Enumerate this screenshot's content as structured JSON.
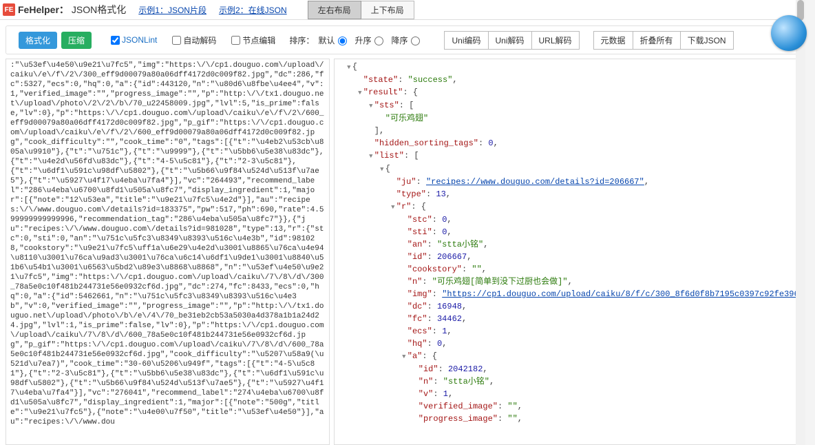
{
  "top": {
    "brand_icon": "FE",
    "brand": "FeHelper：",
    "subtitle": "JSON格式化",
    "example1": "示例1：JSON片段",
    "example2": "示例2：在线JSON",
    "layout_lr": "左右布局",
    "layout_tb": "上下布局"
  },
  "toolbar": {
    "format": "格式化",
    "compress": "压缩",
    "jsonlint": "JSONLint",
    "autodecode": "自动解码",
    "editnode": "节点编辑",
    "sort_label": "排序：",
    "sort_default": "默认",
    "sort_asc": "升序",
    "sort_desc": "降序",
    "uni_encode": "Uni编码",
    "uni_decode": "Uni解码",
    "url_decode": "URL解码",
    "meta": "元数据",
    "collapse_all": "折叠所有",
    "download": "下载JSON"
  },
  "raw": ":\"\\u53ef\\u4e50\\u9e21\\u7fc5\",\"img\":\"https:\\/\\/cp1.douguo.com\\/upload\\/caiku\\/e\\/f\\/2\\/300_eff9d00079a80a06dff4172d0c009f82.jpg\",\"dc\":286,\"fc\":5327,\"ecs\":0,\"hq\":0,\"a\":{\"id\":443120,\"n\":\"\\u80d6\\u8fbe\\u4ee4\",\"v\":1,\"verified_image\":\"\",\"progress_image\":\"\",\"p\":\"http:\\/\\/tx1.douguo.net\\/upload\\/photo\\/2\\/2\\/b\\/70_u22458009.jpg\",\"lvl\":5,\"is_prime\":false,\"lv\":0},\"p\":\"https:\\/\\/cp1.douguo.com\\/upload\\/caiku\\/e\\/f\\/2\\/600_eff9d00079a80a06dff4172d0c009f82.jpg\",\"p_gif\":\"https:\\/\\/cp1.douguo.com\\/upload\\/caiku\\/e\\/f\\/2\\/600_eff9d00079a80a06dff4172d0c009f82.jpg\",\"cook_difficulty\":\"\",\"cook_time\":\"0\",\"tags\":[{\"t\":\"\\u4eb2\\u53cb\\u805a\\u9910\"},{\"t\":\"\\u751c\"},{\"t\":\"\\u9999\"},{\"t\":\"\\u5bb6\\u5e38\\u83dc\"},{\"t\":\"\\u4e2d\\u56fd\\u83dc\"},{\"t\":\"4-5\\u5c81\"},{\"t\":\"2-3\\u5c81\"},{\"t\":\"\\u6df1\\u591c\\u98df\\u5802\"},{\"t\":\"\\u5b66\\u9f84\\u524d\\u513f\\u7ae5\"},{\"t\":\"\\u5927\\u4f17\\u4eba\\u7fa4\"}],\"vc\":\"264493\",\"recommend_label\":\"286\\u4eba\\u6700\\u8fd1\\u505a\\u8fc7\",\"display_ingredient\":1,\"major\":[{\"note\":\"12\\u53ea\",\"title\":\"\\u9e21\\u7fc5\\u4e2d\"}],\"au\":\"recipes:\\/\\/www.douguo.com\\/details?id=183375\",\"pw\":517,\"ph\":690,\"rate\":4.599999999999996,\"recommendation_tag\":\"286\\u4eba\\u505a\\u8fc7\"}},{\"ju\":\"recipes:\\/\\/www.douguo.com\\/details?id=981028\",\"type\":13,\"r\":{\"stc\":0,\"sti\":0,\"an\":\"\\u751c\\u5fc3\\u8349\\u8393\\u516c\\u4e3b\",\"id\":981028,\"cookstory\":\"\\u9e21\\u7fc5\\uff1a\\u6e29\\u4e2d\\u3001\\u8865\\u76ca\\u4e94\\u8110\\u3001\\u76ca\\u9ad3\\u3001\\u76ca\\u6c14\\u6df1\\u9de1\\u3001\\u8840\\u51b6\\u54b1\\u3001\\u6563\\u5bd2\\u89e3\\u8868\\u8868\",\"n\":\"\\u53ef\\u4e50\\u9e21\\u7fc5\",\"img\":\"https:\\/\\/cp1.douguo.com\\/upload\\/caiku\\/7\\/8\\/d\\/300_78a5e0c10f481b244731e56e0932cf6d.jpg\",\"dc\":274,\"fc\":8433,\"ecs\":0,\"hq\":0,\"a\":{\"id\":5462661,\"n\":\"\\u751c\\u5fc3\\u8349\\u8393\\u516c\\u4e3b\",\"v\":0,\"verified_image\":\"\",\"progress_image\":\"\",\"p\":\"http:\\/\\/tx1.douguo.net\\/upload\\/photo\\/b\\/e\\/4\\/70_be31eb2cb53a5030a4d378a1b1a24d24.jpg\",\"lvl\":1,\"is_prime\":false,\"lv\":0},\"p\":\"https:\\/\\/cp1.douguo.com\\/upload\\/caiku\\/7\\/8\\/d\\/600_78a5e0c10f481b244731e56e0932cf6d.jpg\",\"p_gif\":\"https:\\/\\/cp1.douguo.com\\/upload\\/caiku\\/7\\/8\\/d\\/600_78a5e0c10f481b244731e56e0932cf6d.jpg\",\"cook_difficulty\":\"\\u5207\\u58a9(\\u521d\\u7ea7)\",\"cook_time\":\"30-60\\u5206\\u949f\",\"tags\":[{\"t\":\"4-5\\u5c81\"},{\"t\":\"2-3\\u5c81\"},{\"t\":\"\\u5bb6\\u5e38\\u83dc\"},{\"t\":\"\\u6df1\\u591c\\u98df\\u5802\"},{\"t\":\"\\u5b66\\u9f84\\u524d\\u513f\\u7ae5\"},{\"t\":\"\\u5927\\u4f17\\u4eba\\u7fa4\"}],\"vc\":\"276041\",\"recommend_label\":\"274\\u4eba\\u6700\\u8fd1\\u505a\\u8fc7\",\"display_ingredient\":1,\"major\":[{\"note\":\"500g\",\"title\":\"\\u9e21\\u7fc5\"},{\"note\":\"\\u4e00\\u7f50\",\"title\":\"\\u53ef\\u4e50\"}],\"au\":\"recipes:\\/\\/www.dou",
  "tree": [
    {
      "d": 0,
      "a": "down",
      "kv": [
        [
          "p",
          "{"
        ]
      ]
    },
    {
      "d": 1,
      "a": "none",
      "kv": [
        [
          "k",
          "\"state\""
        ],
        [
          "p",
          ":   "
        ],
        [
          "s",
          "\"success\""
        ],
        [
          "p",
          ","
        ]
      ]
    },
    {
      "d": 1,
      "a": "down",
      "kv": [
        [
          "k",
          "\"result\""
        ],
        [
          "p",
          ":   {"
        ]
      ]
    },
    {
      "d": 2,
      "a": "down",
      "kv": [
        [
          "k",
          "\"sts\""
        ],
        [
          "p",
          ":  ["
        ]
      ]
    },
    {
      "d": 3,
      "a": "none",
      "kv": [
        [
          "s",
          "\"可乐鸡翅\""
        ]
      ]
    },
    {
      "d": 2,
      "a": "none",
      "kv": [
        [
          "p",
          "],"
        ]
      ]
    },
    {
      "d": 2,
      "a": "none",
      "kv": [
        [
          "k",
          "\"hidden_sorting_tags\""
        ],
        [
          "p",
          ":   "
        ],
        [
          "n",
          "0"
        ],
        [
          "p",
          ","
        ]
      ]
    },
    {
      "d": 2,
      "a": "down",
      "kv": [
        [
          "k",
          "\"list\""
        ],
        [
          "p",
          ":  ["
        ]
      ]
    },
    {
      "d": 3,
      "a": "down",
      "kv": [
        [
          "p",
          "{"
        ]
      ]
    },
    {
      "d": 4,
      "a": "none",
      "kv": [
        [
          "k",
          "\"ju\""
        ],
        [
          "p",
          ":   "
        ],
        [
          "l",
          "\"recipes://www.douguo.com/details?id=206667\""
        ],
        [
          "p",
          ","
        ]
      ]
    },
    {
      "d": 4,
      "a": "none",
      "kv": [
        [
          "k",
          "\"type\""
        ],
        [
          "p",
          ":   "
        ],
        [
          "n",
          "13"
        ],
        [
          "p",
          ","
        ]
      ]
    },
    {
      "d": 4,
      "a": "down",
      "kv": [
        [
          "k",
          "\"r\""
        ],
        [
          "p",
          ":   {"
        ]
      ]
    },
    {
      "d": 5,
      "a": "none",
      "kv": [
        [
          "k",
          "\"stc\""
        ],
        [
          "p",
          ":   "
        ],
        [
          "n",
          "0"
        ],
        [
          "p",
          ","
        ]
      ]
    },
    {
      "d": 5,
      "a": "none",
      "kv": [
        [
          "k",
          "\"sti\""
        ],
        [
          "p",
          ":   "
        ],
        [
          "n",
          "0"
        ],
        [
          "p",
          ","
        ]
      ]
    },
    {
      "d": 5,
      "a": "none",
      "kv": [
        [
          "k",
          "\"an\""
        ],
        [
          "p",
          ":   "
        ],
        [
          "s",
          "\"stta小铭\""
        ],
        [
          "p",
          ","
        ]
      ]
    },
    {
      "d": 5,
      "a": "none",
      "kv": [
        [
          "k",
          "\"id\""
        ],
        [
          "p",
          ":   "
        ],
        [
          "n",
          "206667"
        ],
        [
          "p",
          ","
        ]
      ]
    },
    {
      "d": 5,
      "a": "none",
      "kv": [
        [
          "k",
          "\"cookstory\""
        ],
        [
          "p",
          ":   "
        ],
        [
          "s",
          "\"\""
        ],
        [
          "p",
          ","
        ]
      ]
    },
    {
      "d": 5,
      "a": "none",
      "kv": [
        [
          "k",
          "\"n\""
        ],
        [
          "p",
          ":   "
        ],
        [
          "s",
          "\"可乐鸡翅[简单到没下过厨也会做]\""
        ],
        [
          "p",
          ","
        ]
      ]
    },
    {
      "d": 5,
      "a": "none",
      "kv": [
        [
          "k",
          "\"img\""
        ],
        [
          "p",
          ":   "
        ],
        [
          "l",
          "\"https://cp1.douguo.com/upload/caiku/8/f/c/300_8f6d0f8b7195c0397c92fe39643761fc.jpg\""
        ],
        [
          "p",
          ","
        ]
      ]
    },
    {
      "d": 5,
      "a": "none",
      "kv": [
        [
          "k",
          "\"dc\""
        ],
        [
          "p",
          ":   "
        ],
        [
          "n",
          "16948"
        ],
        [
          "p",
          ","
        ]
      ]
    },
    {
      "d": 5,
      "a": "none",
      "kv": [
        [
          "k",
          "\"fc\""
        ],
        [
          "p",
          ":   "
        ],
        [
          "n",
          "34462"
        ],
        [
          "p",
          ","
        ]
      ]
    },
    {
      "d": 5,
      "a": "none",
      "kv": [
        [
          "k",
          "\"ecs\""
        ],
        [
          "p",
          ":   "
        ],
        [
          "n",
          "1"
        ],
        [
          "p",
          ","
        ]
      ]
    },
    {
      "d": 5,
      "a": "none",
      "kv": [
        [
          "k",
          "\"hq\""
        ],
        [
          "p",
          ":   "
        ],
        [
          "n",
          "0"
        ],
        [
          "p",
          ","
        ]
      ]
    },
    {
      "d": 5,
      "a": "down",
      "kv": [
        [
          "k",
          "\"a\""
        ],
        [
          "p",
          ":   {"
        ]
      ]
    },
    {
      "d": 6,
      "a": "none",
      "kv": [
        [
          "k",
          "\"id\""
        ],
        [
          "p",
          ":   "
        ],
        [
          "n",
          "2042182"
        ],
        [
          "p",
          ","
        ]
      ]
    },
    {
      "d": 6,
      "a": "none",
      "kv": [
        [
          "k",
          "\"n\""
        ],
        [
          "p",
          ":   "
        ],
        [
          "s",
          "\"stta小铭\""
        ],
        [
          "p",
          ","
        ]
      ]
    },
    {
      "d": 6,
      "a": "none",
      "kv": [
        [
          "k",
          "\"v\""
        ],
        [
          "p",
          ":   "
        ],
        [
          "n",
          "1"
        ],
        [
          "p",
          ","
        ]
      ]
    },
    {
      "d": 6,
      "a": "none",
      "kv": [
        [
          "k",
          "\"verified_image\""
        ],
        [
          "p",
          ":   "
        ],
        [
          "s",
          "\"\""
        ],
        [
          "p",
          ","
        ]
      ]
    },
    {
      "d": 6,
      "a": "none",
      "kv": [
        [
          "k",
          "\"progress_image\""
        ],
        [
          "p",
          ":   "
        ],
        [
          "s",
          "\"\""
        ],
        [
          "p",
          ","
        ]
      ]
    }
  ]
}
